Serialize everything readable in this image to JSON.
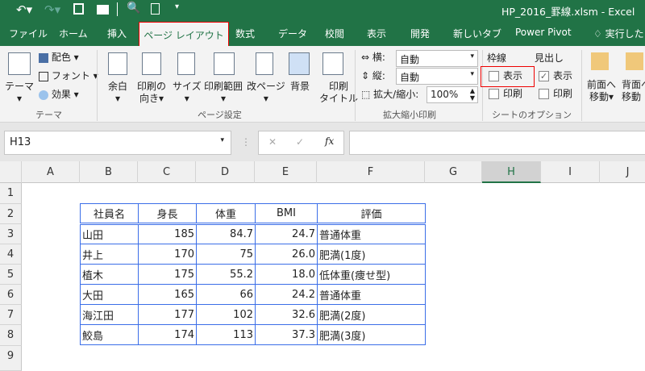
{
  "window": {
    "title": "HP_2016_罫線.xlsm - Excel"
  },
  "tabs": [
    "ファイル",
    "ホーム",
    "挿入",
    "ページ レイアウト",
    "数式",
    "データ",
    "校閲",
    "表示",
    "開発",
    "新しいタブ",
    "Power Pivot",
    "実行したい"
  ],
  "ribbon": {
    "theme": {
      "theme": "テーマ",
      "colors": "配色",
      "fonts": "フォント",
      "effects": "効果",
      "group": "テーマ"
    },
    "page_setup": {
      "margins": "余白",
      "orientation_1": "印刷の",
      "orientation_2": "向き",
      "size": "サイズ",
      "print_area": "印刷範囲",
      "breaks": "改ページ",
      "background": "背景",
      "titles_1": "印刷",
      "titles_2": "タイトル",
      "group": "ページ設定"
    },
    "scale": {
      "width_label": "横:",
      "width_value": "自動",
      "height_label": "縦:",
      "height_value": "自動",
      "scale_label": "拡大/縮小:",
      "scale_value": "100%",
      "group": "拡大縮小印刷"
    },
    "sheet_options": {
      "gridlines": "枠線",
      "headings": "見出し",
      "view": "表示",
      "print": "印刷",
      "group": "シートのオプション",
      "gridlines_view": false,
      "gridlines_print": false,
      "headings_view": true,
      "headings_print": false
    },
    "arrange": {
      "front_1": "前面へ",
      "front_2": "移動",
      "back_1": "背面へ",
      "back_2": "移動"
    }
  },
  "formula_bar": {
    "name_box": "H13",
    "formula": "",
    "fx": "fx"
  },
  "columns": [
    "A",
    "B",
    "C",
    "D",
    "E",
    "F",
    "G",
    "H",
    "I",
    "J"
  ],
  "rows": [
    "1",
    "2",
    "3",
    "4",
    "5",
    "6",
    "7",
    "8",
    "9"
  ],
  "table": {
    "headers": [
      "社員名",
      "身長",
      "体重",
      "BMI",
      "評価"
    ],
    "rows": [
      [
        "山田",
        "185",
        "84.7",
        "24.7",
        "普通体重"
      ],
      [
        "井上",
        "170",
        "75",
        "26.0",
        "肥満(1度)"
      ],
      [
        "植木",
        "175",
        "55.2",
        "18.0",
        "低体重(痩せ型)"
      ],
      [
        "大田",
        "165",
        "66",
        "24.2",
        "普通体重"
      ],
      [
        "海江田",
        "177",
        "102",
        "32.6",
        "肥満(2度)"
      ],
      [
        "鮫島",
        "174",
        "113",
        "37.3",
        "肥満(3度)"
      ]
    ]
  }
}
